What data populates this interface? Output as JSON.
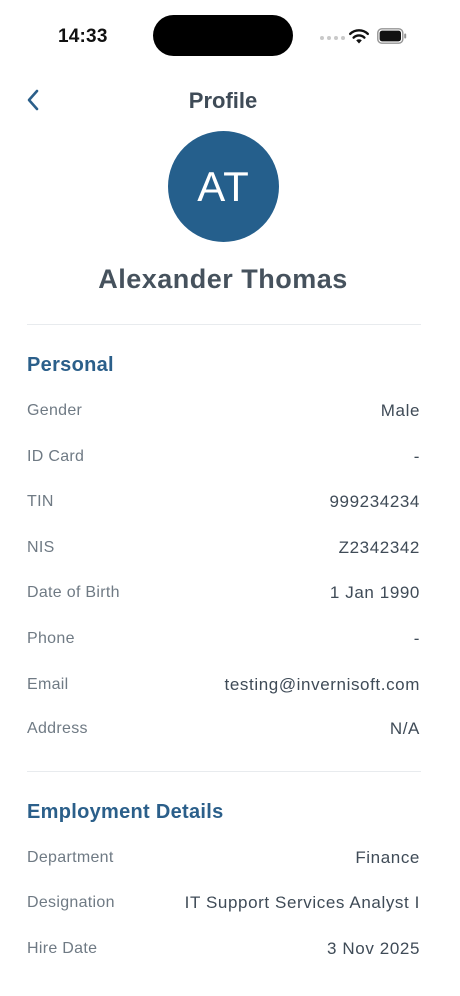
{
  "status_bar": {
    "time": "14:33"
  },
  "header": {
    "title": "Profile",
    "back_icon": "chevron-left-icon"
  },
  "profile": {
    "initials": "AT",
    "name": "Alexander Thomas",
    "avatar_color": "#255f8c"
  },
  "personal": {
    "title": "Personal",
    "rows": [
      {
        "label": "Gender",
        "value": "Male"
      },
      {
        "label": "ID Card",
        "value": "-"
      },
      {
        "label": "TIN",
        "value": "999234234"
      },
      {
        "label": "NIS",
        "value": "Z2342342"
      },
      {
        "label": "Date of Birth",
        "value": "1 Jan 1990"
      },
      {
        "label": "Phone",
        "value": "-"
      },
      {
        "label": "Email",
        "value": "testing@invernisoft.com"
      },
      {
        "label": "Address",
        "value": "N/A"
      }
    ]
  },
  "employment": {
    "title": "Employment Details",
    "rows": [
      {
        "label": "Department",
        "value": "Finance"
      },
      {
        "label": "Designation",
        "value": "IT Support Services Analyst I"
      },
      {
        "label": "Hire Date",
        "value": "3 Nov 2025"
      }
    ]
  },
  "colors": {
    "accent": "#2b5f8a",
    "text": "#3f4b57",
    "label": "#6f7a84"
  }
}
